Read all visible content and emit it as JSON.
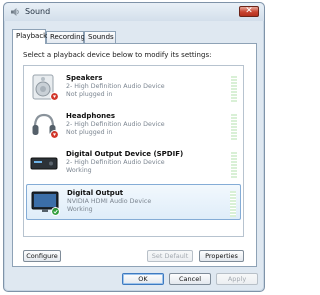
{
  "window": {
    "title": "Sound",
    "close_label": "✕"
  },
  "tabs": [
    {
      "label": "Playback",
      "active": true
    },
    {
      "label": "Recording",
      "active": false
    },
    {
      "label": "Sounds",
      "active": false
    }
  ],
  "instruction": "Select a playback device below to modify its settings:",
  "devices": [
    {
      "name": "Speakers",
      "description": "2- High Definition Audio Device",
      "status": "Not plugged in",
      "icon": "speakers-icon",
      "badge": "red-down-arrow"
    },
    {
      "name": "Headphones",
      "description": "2- High Definition Audio Device",
      "status": "Not plugged in",
      "icon": "headphones-icon",
      "badge": "red-down-arrow"
    },
    {
      "name": "Digital Output Device (SPDIF)",
      "description": "2- High Definition Audio Device",
      "status": "Working",
      "icon": "spdif-device-icon",
      "badge": "none"
    },
    {
      "name": "Digital Output",
      "description": "NVIDIA HDMI Audio Device",
      "status": "Working",
      "icon": "monitor-icon",
      "badge": "green-check",
      "selected": true
    }
  ],
  "buttons": {
    "configure": "Configure",
    "set_default": "Set Default",
    "properties": "Properties",
    "ok": "OK",
    "cancel": "Cancel",
    "apply": "Apply"
  },
  "colors": {
    "selection_border": "#84acd6",
    "close_red": "#c8432f",
    "badge_red": "#d2372b",
    "badge_green": "#2f9e3a"
  }
}
